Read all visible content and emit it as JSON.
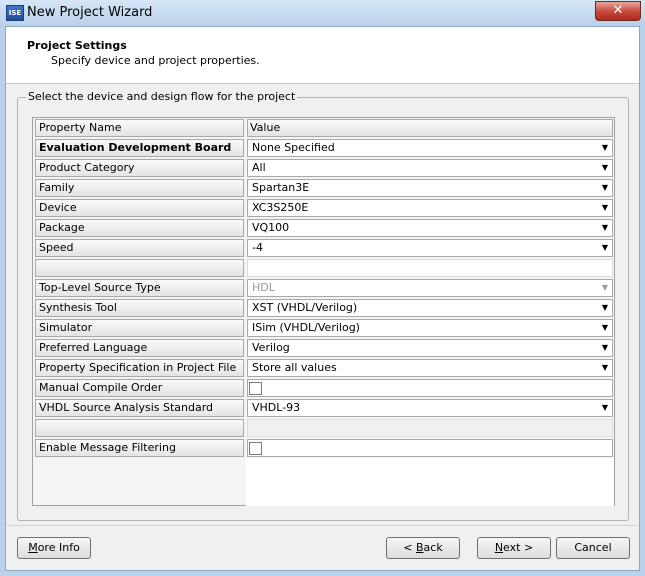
{
  "window": {
    "title": "New Project Wizard",
    "icon_text": "ISE",
    "close_glyph": "✕"
  },
  "header": {
    "title": "Project Settings",
    "subtitle": "Specify device and project properties."
  },
  "group": {
    "title": "Select the device and design flow for the project"
  },
  "table": {
    "columns": [
      "Property Name",
      "Value"
    ],
    "rows": [
      {
        "name": "Evaluation Development Board",
        "value": "None Specified"
      },
      {
        "name": "Product Category",
        "value": "All"
      },
      {
        "name": "Family",
        "value": "Spartan3E"
      },
      {
        "name": "Device",
        "value": "XC3S250E"
      },
      {
        "name": "Package",
        "value": "VQ100"
      },
      {
        "name": "Speed",
        "value": "-4"
      },
      {
        "name": "",
        "value": ""
      },
      {
        "name": "Top-Level Source Type",
        "value": "HDL"
      },
      {
        "name": "Synthesis Tool",
        "value": "XST (VHDL/Verilog)"
      },
      {
        "name": "Simulator",
        "value": "ISim (VHDL/Verilog)"
      },
      {
        "name": "Preferred Language",
        "value": "Verilog"
      },
      {
        "name": "Property Specification in Project File",
        "value": "Store all values"
      },
      {
        "name": "Manual Compile Order",
        "value": ""
      },
      {
        "name": "VHDL Source Analysis Standard",
        "value": "VHDL-93"
      },
      {
        "name": "",
        "value": ""
      },
      {
        "name": "Enable Message Filtering",
        "value": ""
      }
    ]
  },
  "buttons": {
    "more_info": {
      "first": "M",
      "rest": "ore Info"
    },
    "back": {
      "pre": "< ",
      "ul": "B",
      "post": "ack"
    },
    "next": {
      "ul": "N",
      "post": "ext >"
    },
    "cancel": "Cancel"
  },
  "icons": {
    "dropdown": "▼"
  }
}
